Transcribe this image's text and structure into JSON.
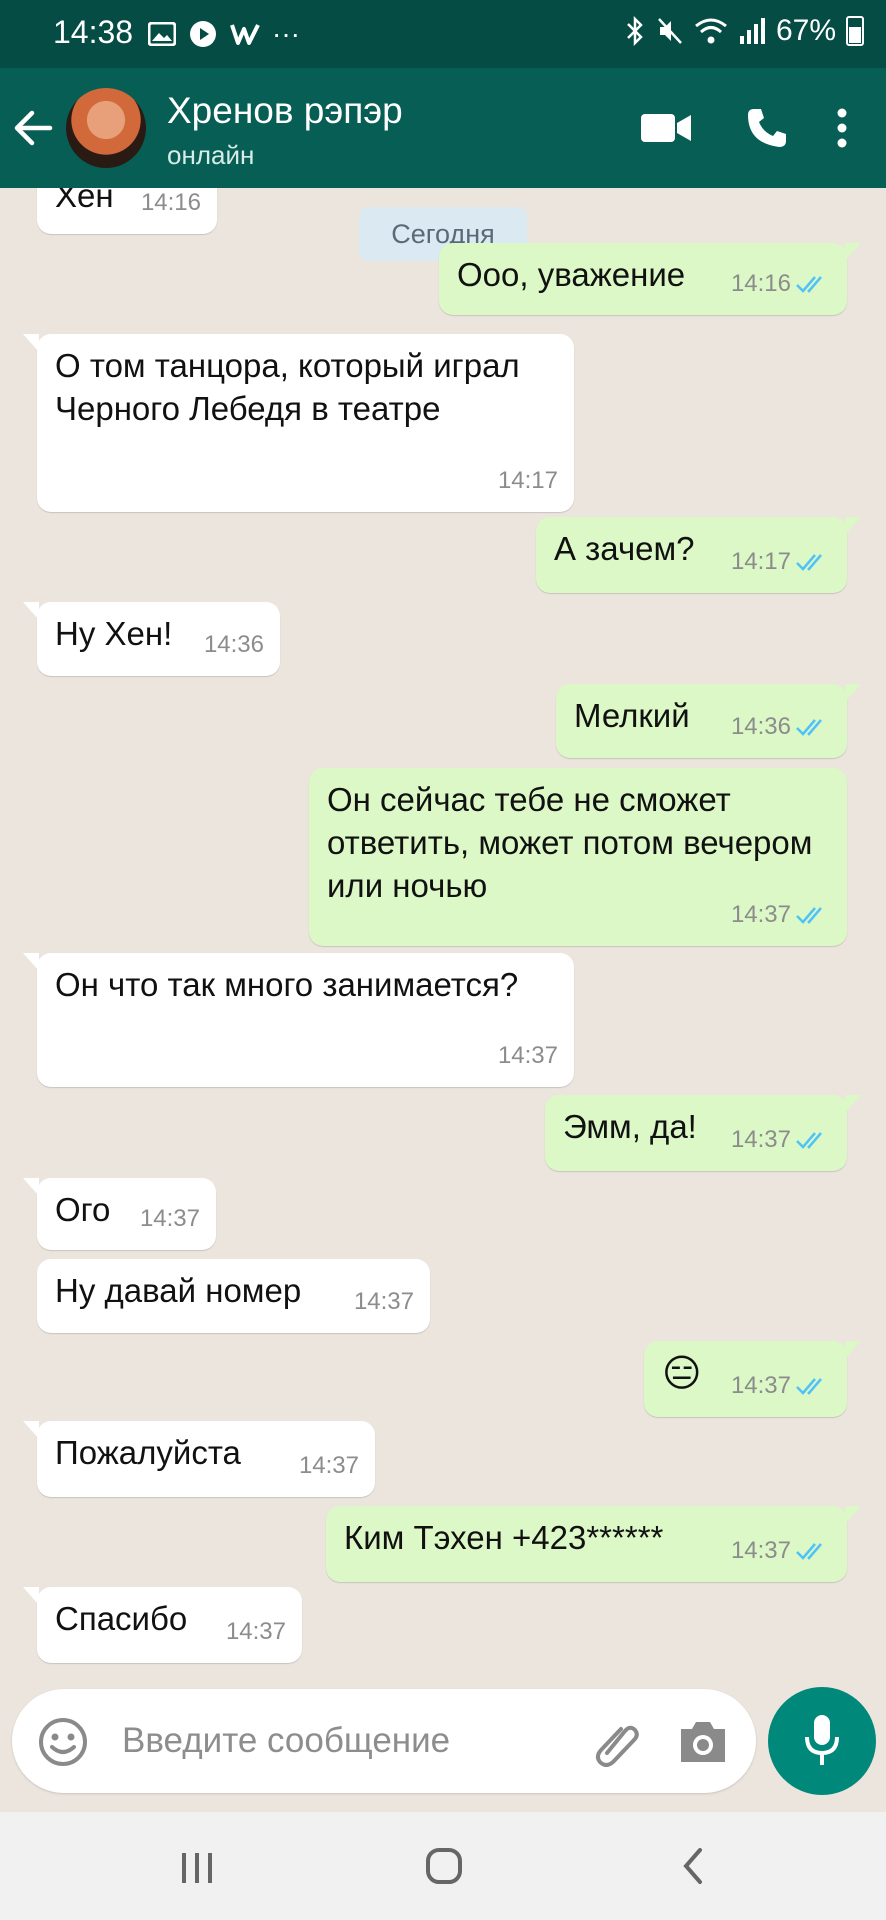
{
  "status_bar": {
    "time": "14:38",
    "battery": "67%"
  },
  "header": {
    "contact_name": "Хренов рэпэр",
    "contact_status": "онлайн",
    "icons": [
      "back-arrow-icon",
      "video-call-icon",
      "phone-icon",
      "more-vert-icon"
    ]
  },
  "chat": {
    "date_separator": "Сегодня",
    "messages": [
      {
        "dir": "in",
        "text": "Хен",
        "time": "14:16"
      },
      {
        "dir": "out",
        "text": "Ооо, уважение",
        "time": "14:16",
        "read": true
      },
      {
        "dir": "in",
        "text": "О том танцора, который играл Черного Лебедя в театре",
        "time": "14:17"
      },
      {
        "dir": "out",
        "text": "А зачем?",
        "time": "14:17",
        "read": true
      },
      {
        "dir": "in",
        "text": "Ну Хен!",
        "time": "14:36"
      },
      {
        "dir": "out",
        "text": "Мелкий",
        "time": "14:36",
        "read": true
      },
      {
        "dir": "out",
        "text": "Он сейчас тебе не сможет ответить, может потом вечером или ночью",
        "time": "14:37",
        "read": true
      },
      {
        "dir": "in",
        "text": "Он что так много занимается?",
        "time": "14:37"
      },
      {
        "dir": "out",
        "text": "Эмм, да!",
        "time": "14:37",
        "read": true
      },
      {
        "dir": "in",
        "text": "Ого",
        "time": "14:37"
      },
      {
        "dir": "in",
        "text": "Ну давай номер",
        "time": "14:37"
      },
      {
        "dir": "out",
        "text": "😑",
        "time": "14:37",
        "read": true
      },
      {
        "dir": "in",
        "text": "Пожалуйста",
        "time": "14:37"
      },
      {
        "dir": "out",
        "text": "Ким Тэхен +423******",
        "time": "14:37",
        "read": true
      },
      {
        "dir": "in",
        "text": "Спасибо",
        "time": "14:37"
      }
    ]
  },
  "composer": {
    "placeholder": "Введите сообщение",
    "icons": [
      "emoji-icon",
      "attach-icon",
      "camera-icon",
      "mic-icon"
    ]
  },
  "nav_bar": {
    "icons": [
      "recent-apps-icon",
      "home-icon",
      "back-nav-icon"
    ]
  },
  "colors": {
    "status_bar": "#054c44",
    "header": "#075e54",
    "chat_background": "#ece5dd",
    "incoming_bubble": "#ffffff",
    "outgoing_bubble": "#dcf8c6",
    "read_ticks": "#4fc3f7",
    "mic_button": "#00887a"
  }
}
